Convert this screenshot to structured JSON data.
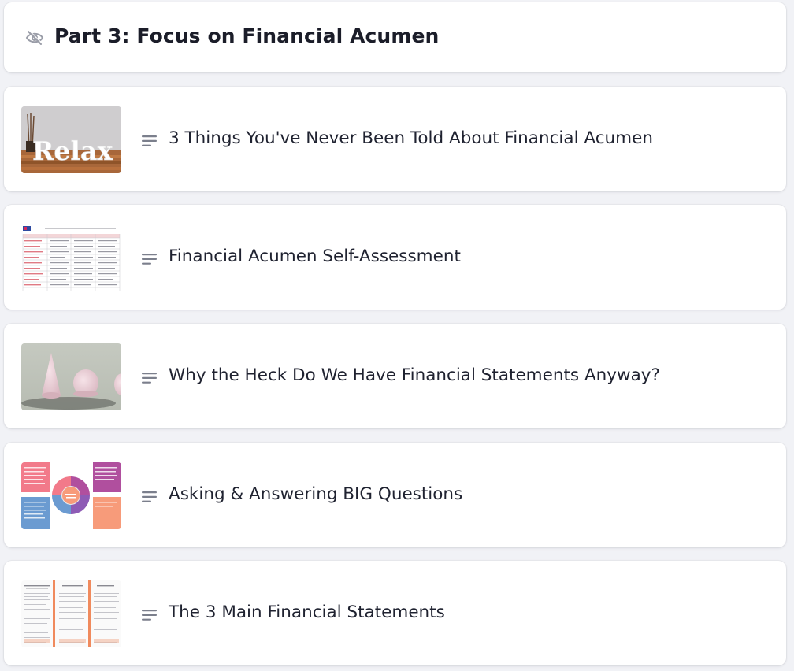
{
  "section": {
    "title": "Part 3: Focus on Financial Acumen",
    "visibility_icon": "eye-slash-icon"
  },
  "lessons": [
    {
      "title": "3 Things You've Never Been Told About Financial Acumen",
      "thumbnail_text": "Relax",
      "type_icon": "text-lines-icon"
    },
    {
      "title": "Financial Acumen Self-Assessment",
      "type_icon": "text-lines-icon"
    },
    {
      "title": "Why the Heck Do We Have Financial Statements Anyway?",
      "type_icon": "text-lines-icon"
    },
    {
      "title": "Asking & Answering BIG Questions",
      "type_icon": "text-lines-icon"
    },
    {
      "title": "The 3 Main Financial Statements",
      "type_icon": "text-lines-icon"
    }
  ],
  "colors": {
    "page_background": "#f1f2f6",
    "card_background": "#ffffff",
    "title_text": "#1b1d29",
    "icon_gray": "#7b7f8c"
  }
}
